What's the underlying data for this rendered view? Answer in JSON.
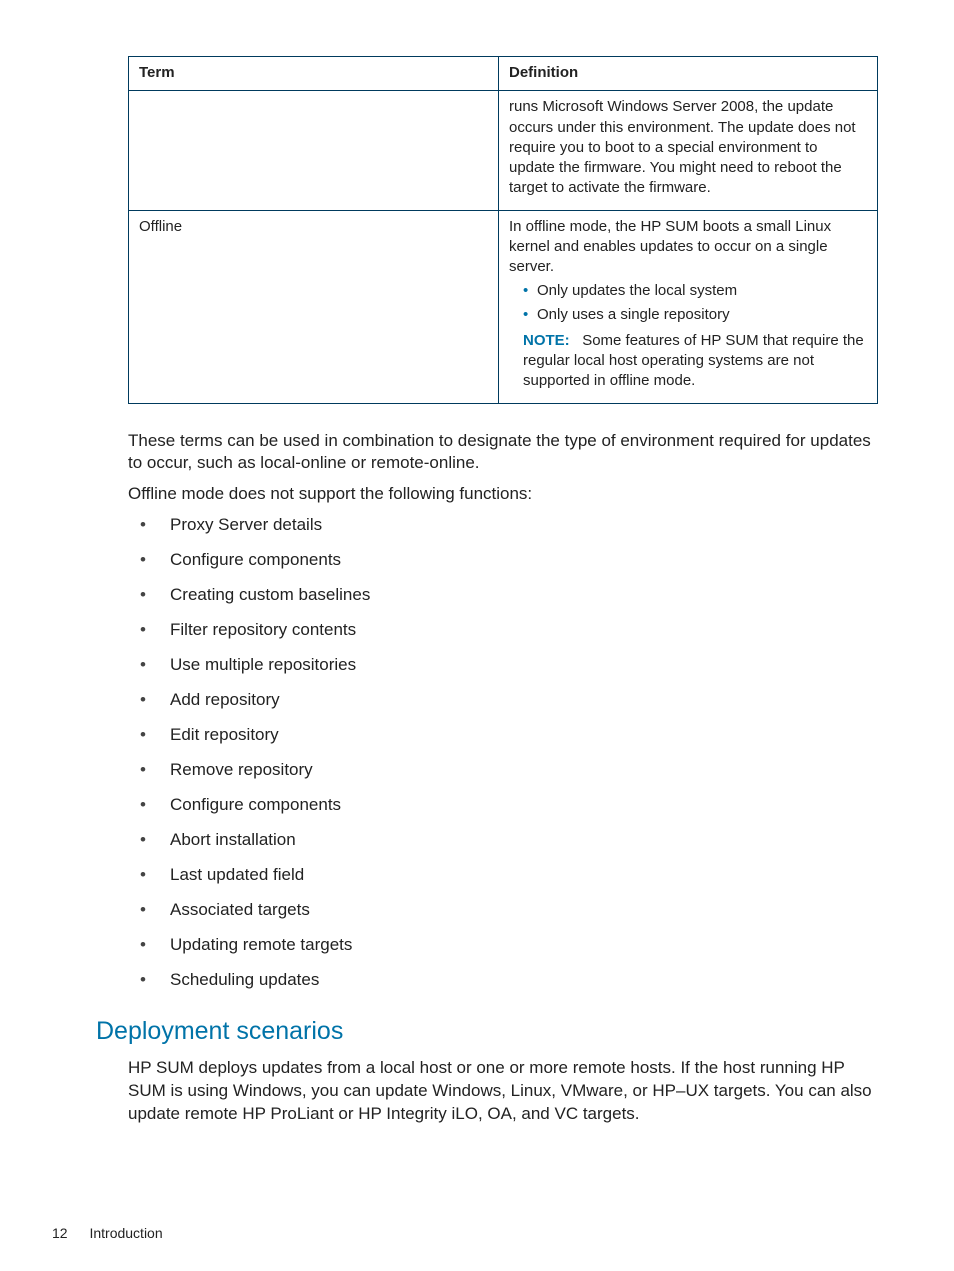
{
  "table": {
    "headers": {
      "term": "Term",
      "definition": "Definition"
    },
    "row_continuation": {
      "term": "",
      "definition": "runs Microsoft Windows Server 2008, the update occurs under this environment. The update does not require you to boot to a special environment to update the firmware. You might need to reboot the target to activate the firmware."
    },
    "row_offline": {
      "term": "Offline",
      "intro": "In offline mode, the HP SUM boots a small Linux kernel and enables updates to occur on a single server.",
      "bullets": [
        "Only updates the local system",
        "Only uses a single repository"
      ],
      "note_label": "NOTE:",
      "note_text": "Some features of HP SUM that require the regular local host operating systems are not supported in offline mode."
    }
  },
  "para1": "These terms can be used in combination to designate the type of environment required for updates to occur, such as local-online or remote-online.",
  "para2": "Offline mode does not support the following functions:",
  "offline_unsupported": [
    "Proxy Server details",
    "Configure components",
    "Creating custom baselines",
    "Filter repository contents",
    "Use multiple repositories",
    "Add repository",
    "Edit repository",
    "Remove repository",
    "Configure components",
    "Abort installation",
    "Last updated field",
    "Associated targets",
    "Updating remote targets",
    "Scheduling updates"
  ],
  "section": {
    "heading": "Deployment scenarios",
    "body": "HP SUM deploys updates from a local host or one or more remote hosts. If the host running HP SUM is using Windows, you can update Windows, Linux, VMware, or HP–UX targets. You can also update remote HP ProLiant or HP Integrity iLO, OA, and VC targets."
  },
  "footer": {
    "page_number": "12",
    "chapter": "Introduction"
  }
}
